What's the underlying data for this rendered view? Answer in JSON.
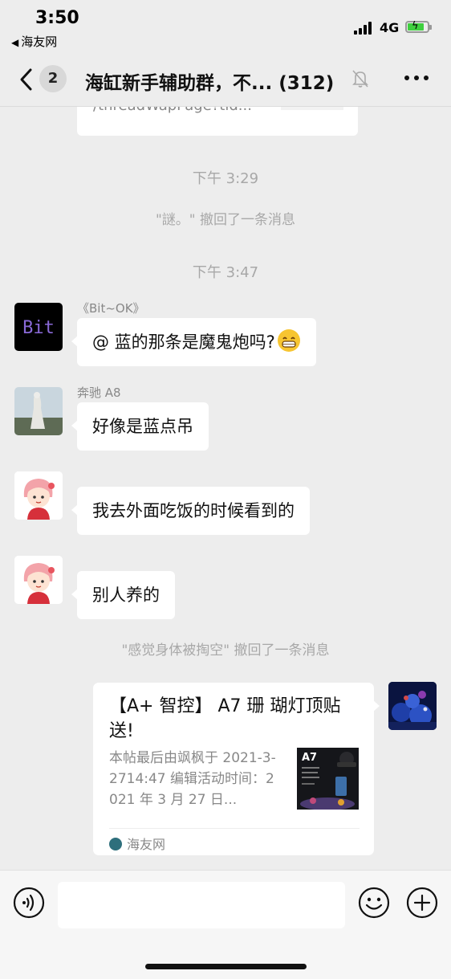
{
  "status_bar": {
    "time": "3:50",
    "back_app": "海友网",
    "network": "4G"
  },
  "nav": {
    "badge": "2",
    "title": "海缸新手辅助群，不... (312)"
  },
  "messages": {
    "prev_card_url": "/threadWapPage?tid...",
    "timestamp1": "下午 3:29",
    "recall1": "\"謎。\" 撤回了一条消息",
    "timestamp2": "下午 3:47",
    "msg1": {
      "nick": "《Bit~OK》",
      "text": "@ 蓝的那条是魔鬼炮吗?",
      "avatar_text": "Bit"
    },
    "msg2": {
      "nick": "奔驰 A8",
      "text": "好像是蓝点吊"
    },
    "msg3": {
      "text": "我去外面吃饭的时候看到的"
    },
    "msg4": {
      "text": "别人养的"
    },
    "recall2": "\"感觉身体被掏空\" 撤回了一条消息",
    "link_card": {
      "title": "【A+ 智控】 A7 珊 瑚灯顶贴送!",
      "desc": "本帖最后由飒枫于 2021-3-2714:47 编辑活动时间：2021 年 3 月 27 日...",
      "thumb_label": "A7",
      "source": "海友网"
    }
  },
  "input": {
    "value": ""
  }
}
